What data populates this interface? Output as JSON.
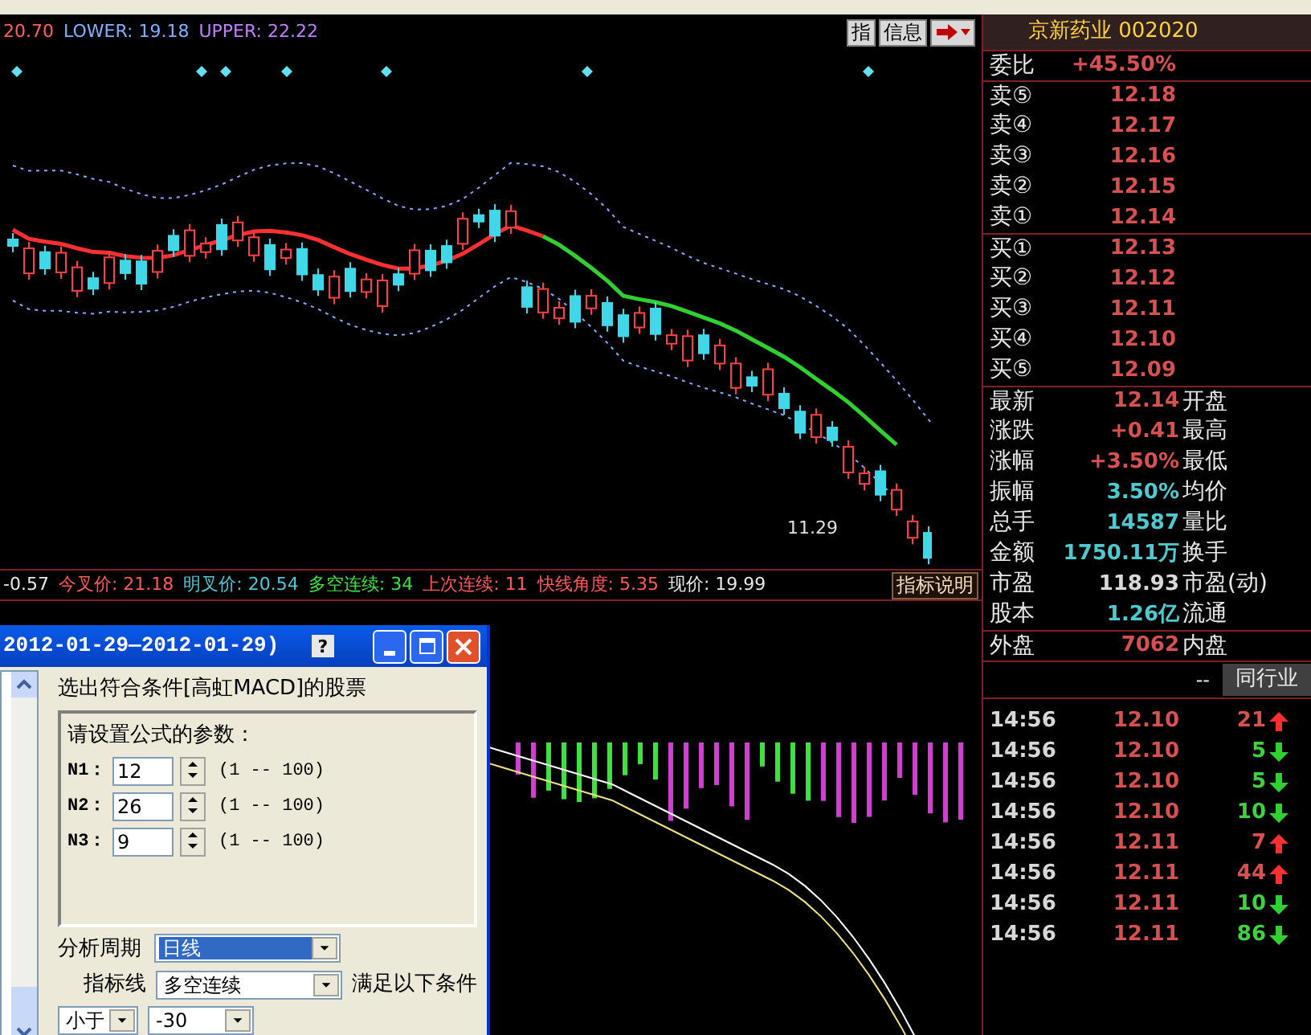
{
  "chart": {
    "mid": "20.70",
    "lower_label": "LOWER: 19.18",
    "upper_label": "UPPER: 22.22",
    "low_mark": "11.29"
  },
  "chart_buttons": [
    {
      "label": "指"
    },
    {
      "label": "信息"
    }
  ],
  "stock_title": "京新药业 002020",
  "indicator_line": [
    {
      "label": "-0.57",
      "kind": "white"
    },
    {
      "label": "今叉价: 21.18",
      "kind": "red"
    },
    {
      "label": "明叉价: 20.54",
      "kind": "cyan"
    },
    {
      "label": "多空连续: 34",
      "kind": "green"
    },
    {
      "label": "上次连续: 11",
      "kind": "red"
    },
    {
      "label": "快线角度: 5.35",
      "kind": "red"
    },
    {
      "label": "现价: 19.99",
      "kind": "white"
    }
  ],
  "indicator_help": "指标说明",
  "dialog": {
    "title": "2012-01-29—2012-01-29)",
    "help": "?",
    "heading": "选出符合条件[高虹MACD]的股票",
    "params_title": "请设置公式的参数：",
    "params": [
      {
        "name": "N1：",
        "value": "12",
        "range": "(1 -- 100)"
      },
      {
        "name": "N2：",
        "value": "26",
        "range": "(1 -- 100)"
      },
      {
        "name": "N3：",
        "value": "9",
        "range": "(1 -- 100)"
      }
    ],
    "period_label": "分析周期",
    "period": "日线",
    "line_label": "指标线",
    "line": "多空连续",
    "suffix": "满足以下条件",
    "compare": "小于",
    "threshold": "-30"
  },
  "quote": {
    "ratio_label": "委比",
    "ratio": "+45.50%",
    "sells": [
      {
        "label": "卖⑤",
        "price": "12.18"
      },
      {
        "label": "卖④",
        "price": "12.17"
      },
      {
        "label": "卖③",
        "price": "12.16"
      },
      {
        "label": "卖②",
        "price": "12.15"
      },
      {
        "label": "卖①",
        "price": "12.14"
      }
    ],
    "buys": [
      {
        "label": "买①",
        "price": "12.13"
      },
      {
        "label": "买②",
        "price": "12.12"
      },
      {
        "label": "买③",
        "price": "12.11"
      },
      {
        "label": "买④",
        "price": "12.10"
      },
      {
        "label": "买⑤",
        "price": "12.09"
      }
    ],
    "stats": [
      {
        "label": "最新",
        "value": "12.14",
        "label2": "开盘",
        "kind": "red"
      },
      {
        "label": "涨跌",
        "value": "+0.41",
        "label2": "最高",
        "kind": "red"
      },
      {
        "label": "涨幅",
        "value": "+3.50%",
        "label2": "最低",
        "kind": "red"
      },
      {
        "label": "振幅",
        "value": "3.50%",
        "label2": "均价",
        "kind": "cyan"
      },
      {
        "label": "总手",
        "value": "14587",
        "label2": "量比",
        "kind": "cyan"
      },
      {
        "label": "金额",
        "value": "1750.11万",
        "label2": "换手",
        "kind": "cyan"
      },
      {
        "label": "市盈",
        "value": "118.93",
        "label2": "市盈(动)",
        "kind": "white"
      },
      {
        "label": "股本",
        "value": "1.26亿",
        "label2": "流通",
        "kind": "cyan"
      }
    ],
    "outer": {
      "label": "外盘",
      "value": "7062",
      "label2": "内盘"
    },
    "dash": "--",
    "tab": "同行业"
  },
  "ticks": [
    {
      "time": "14:56",
      "price": "12.10",
      "volume": "21",
      "kind": "up"
    },
    {
      "time": "14:56",
      "price": "12.10",
      "volume": "5",
      "kind": "down"
    },
    {
      "time": "14:56",
      "price": "12.10",
      "volume": "5",
      "kind": "down"
    },
    {
      "time": "14:56",
      "price": "12.10",
      "volume": "10",
      "kind": "down"
    },
    {
      "time": "14:56",
      "price": "12.11",
      "volume": "7",
      "kind": "up"
    },
    {
      "time": "14:56",
      "price": "12.11",
      "volume": "44",
      "kind": "up"
    },
    {
      "time": "14:56",
      "price": "12.11",
      "volume": "10",
      "kind": "down"
    },
    {
      "time": "14:56",
      "price": "12.11",
      "volume": "86",
      "kind": "down"
    }
  ]
}
